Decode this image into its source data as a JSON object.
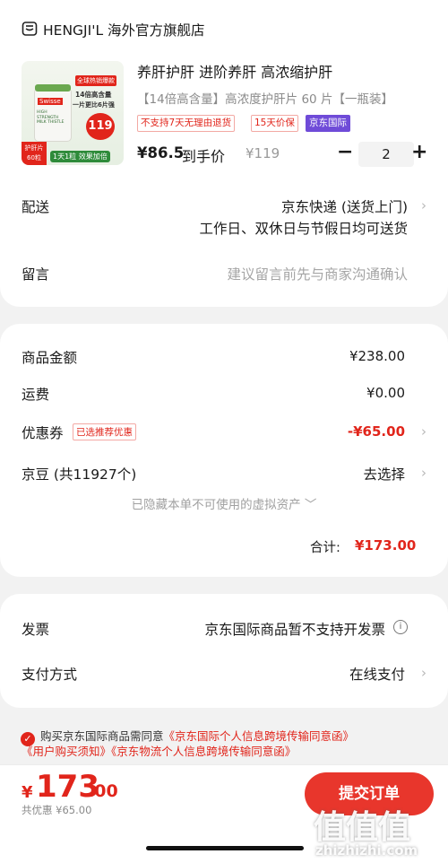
{
  "store": {
    "icon": "store-icon",
    "name": "HENGJI'L 海外官方旗舰店"
  },
  "product": {
    "title": "养肝护肝 进阶养肝 高浓缩护肝",
    "spec": "【14倍高含量】高浓度护肝片 60 片【一瓶装】",
    "tags": [
      "不支持7天无理由退货",
      "15天价保",
      "京东国际"
    ],
    "price": "¥86.5",
    "price_suffix": "到手价",
    "orig_price": "¥119",
    "quantity": "2",
    "thumb": {
      "banner": "全球热销爆款",
      "brand_line": "Swisse",
      "product_line": "HIGH STRENGTH MILK THISTLE",
      "claim1": "14倍高含量",
      "claim2": "一片更比6片强",
      "price_badge": "119",
      "side_badge1": "护肝片",
      "side_badge2": "60粒",
      "bottom_badge": "1天1粒 效果加倍"
    }
  },
  "delivery": {
    "label": "配送",
    "method": "京东快递 (送货上门)",
    "days": "工作日、双休日与节假日均可送货"
  },
  "note": {
    "label": "留言",
    "placeholder": "建议留言前先与商家沟通确认"
  },
  "summary": {
    "goods_label": "商品金额",
    "goods_value": "¥238.00",
    "ship_label": "运费",
    "ship_value": "¥0.00",
    "coupon_label": "优惠券",
    "coupon_tag": "已选推荐优惠",
    "coupon_value": "-¥65.00",
    "jd_bean_label": "京豆 (共11927个)",
    "jd_bean_action": "去选择",
    "hidden_assets": "已隐藏本单不可使用的虚拟资产",
    "total_label": "合计:",
    "total_value": "¥173.00"
  },
  "invoice": {
    "label": "发票",
    "value": "京东国际商品暂不支持开发票"
  },
  "payment": {
    "label": "支付方式",
    "value": "在线支付"
  },
  "agreement": {
    "line1_prefix": "购买京东国际商品需同意",
    "link1": "《京东国际个人信息跨境传输同意函》",
    "link2": "《用户购买须知》",
    "link3": "《京东物流个人信息跨境传输同意函》"
  },
  "footer": {
    "currency": "¥",
    "total_int": "173",
    "total_dec": ".00",
    "discount": "共优惠 ¥65.00",
    "submit": "提交订单"
  },
  "watermark": {
    "text": "值值值",
    "url": "zhizhizhi.com"
  },
  "colors": {
    "accent": "#e1251b",
    "jd_intl": "#6f4bd8",
    "background": "#f2f2f2"
  }
}
